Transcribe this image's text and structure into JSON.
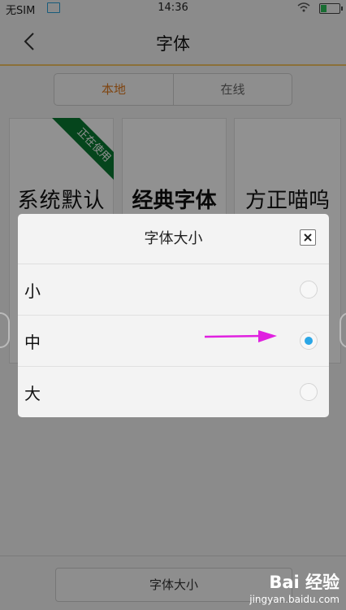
{
  "status_bar": {
    "carrier": "无SIM",
    "time": "14:36",
    "icons": [
      "sim-image-icon",
      "wifi-icon",
      "battery-icon"
    ]
  },
  "nav": {
    "title": "字体",
    "back_icon": "chevron-left-icon"
  },
  "tabs": [
    {
      "label": "本地",
      "selected": true
    },
    {
      "label": "在线",
      "selected": false
    }
  ],
  "font_cards": [
    {
      "name": "系统默认",
      "badge": "正在使用"
    },
    {
      "name": "经典字体"
    },
    {
      "name": "方正喵呜"
    }
  ],
  "dialog": {
    "title": "字体大小",
    "close_icon": "close-icon",
    "options": [
      {
        "label": "小",
        "selected": false
      },
      {
        "label": "中",
        "selected": true
      },
      {
        "label": "大",
        "selected": false
      }
    ]
  },
  "bottom_bar": {
    "button_label": "字体大小"
  },
  "watermark": {
    "logo": "Bai 经验",
    "url": "jingyan.baidu.com"
  },
  "colors": {
    "accent": "#e07a1f",
    "radio_selected": "#2aa6e6",
    "badge_green": "#0a7a32",
    "arrow_magenta": "#e020e0",
    "divider_gold": "#f5c564"
  }
}
